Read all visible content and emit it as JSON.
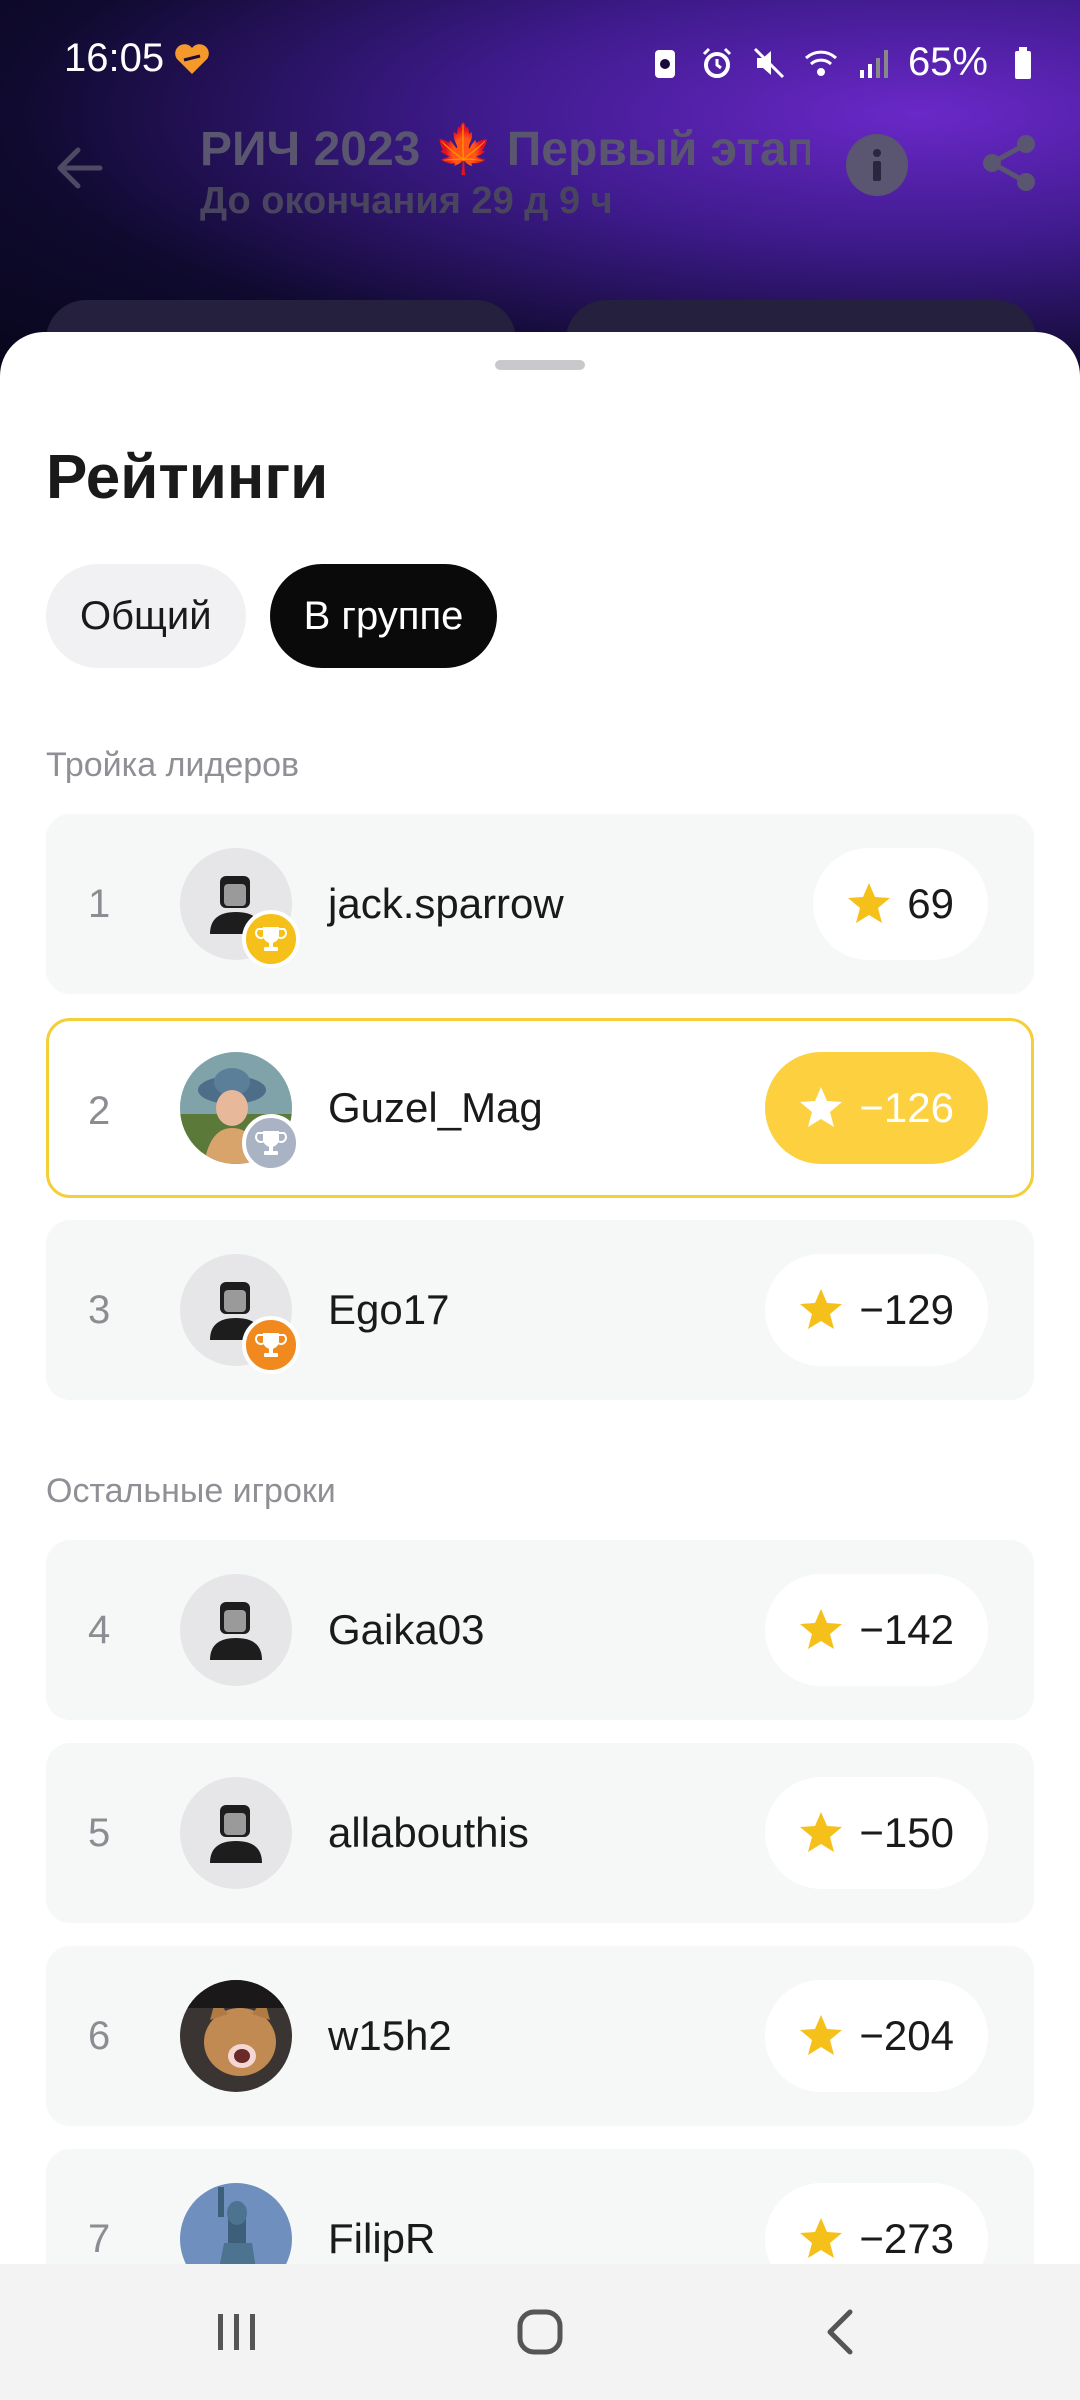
{
  "status_bar": {
    "time": "16:05",
    "battery": "65%",
    "icons": [
      "heart-app-icon",
      "battery-saver-icon",
      "alarm-icon",
      "mute-icon",
      "wifi-icon",
      "signal-icon",
      "battery-icon"
    ]
  },
  "header": {
    "title": "РИЧ 2023 🍁 Первый этап",
    "subtitle": "До окончания 29 д 9 ч",
    "icons": [
      "back-arrow-icon",
      "info-icon",
      "share-icon"
    ]
  },
  "sheet": {
    "title": "Рейтинги",
    "tabs": [
      {
        "label": "Общий",
        "active": false
      },
      {
        "label": "В группе",
        "active": true
      }
    ],
    "leaders_label": "Тройка лидеров",
    "others_label": "Остальные игроки"
  },
  "leaders": [
    {
      "rank": "1",
      "name": "jack.sparrow",
      "score": "69",
      "trophy": "gold",
      "avatar": "default",
      "highlight": false
    },
    {
      "rank": "2",
      "name": "Guzel_Mag",
      "score": "−126",
      "trophy": "silver",
      "avatar": "photo-woman-hat",
      "highlight": true
    },
    {
      "rank": "3",
      "name": "Ego17",
      "score": "−129",
      "trophy": "bronze",
      "avatar": "default",
      "highlight": false
    }
  ],
  "others": [
    {
      "rank": "4",
      "name": "Gaika03",
      "score": "−142",
      "avatar": "default"
    },
    {
      "rank": "5",
      "name": "allabouthis",
      "score": "−150",
      "avatar": "default"
    },
    {
      "rank": "6",
      "name": "w15h2",
      "score": "−204",
      "avatar": "photo-cat"
    },
    {
      "rank": "7",
      "name": "FilipR",
      "score": "−273",
      "avatar": "photo-statue"
    }
  ],
  "colors": {
    "gold": "#fcd03e",
    "trophy_gold": "#f5c01a",
    "trophy_silver": "#a9b3c4",
    "trophy_bronze": "#f08a1e",
    "active_tab": "#0a0a0a"
  },
  "nav_bar": {
    "icons": [
      "recent-apps-icon",
      "home-icon",
      "back-icon"
    ]
  }
}
